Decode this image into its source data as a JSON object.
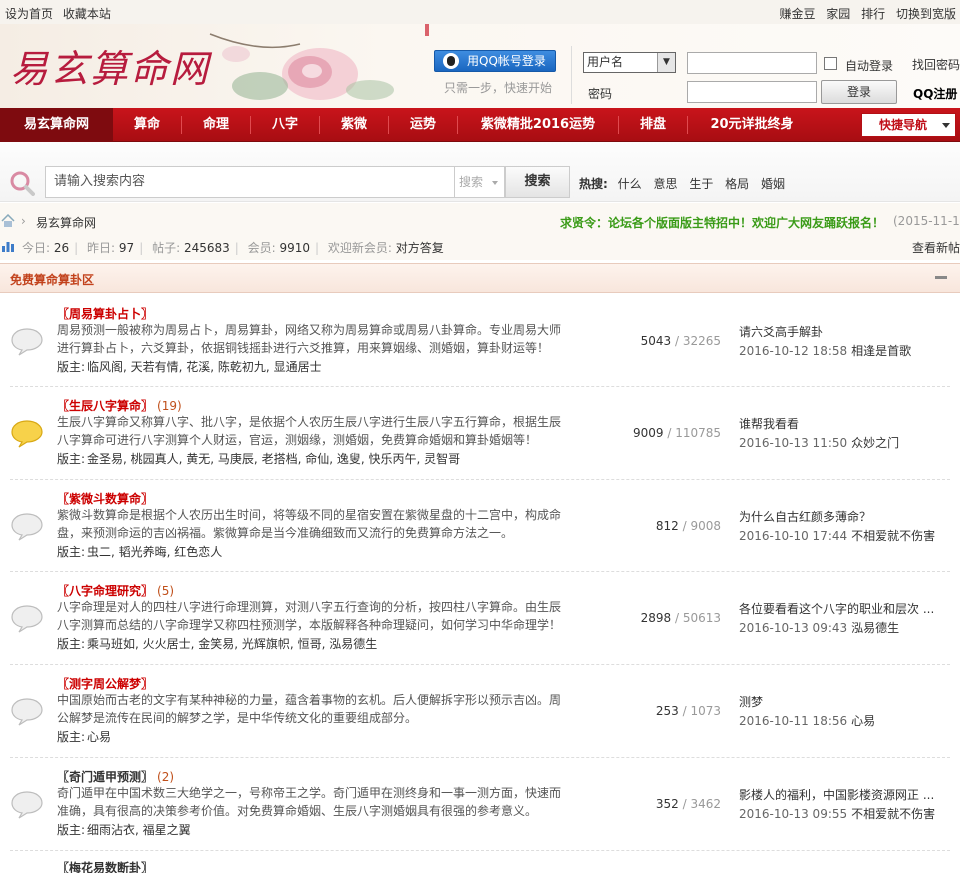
{
  "topbar": {
    "left": [
      "设为首页",
      "收藏本站"
    ],
    "right": [
      "赚金豆",
      "家园",
      "排行",
      "切换到宽版"
    ]
  },
  "header": {
    "logo": "易玄算命网",
    "qq_login": "用QQ帐号登录",
    "qq_hint": "只需一步，快速开始",
    "username_select": "用户名",
    "password_label": "密码",
    "auto_login": "自动登录",
    "find_password": "找回密码",
    "login_button": "登录",
    "qq_register": "QQ注册"
  },
  "nav": {
    "items": [
      "易玄算命网",
      "算命",
      "命理",
      "八字",
      "紫微",
      "运势",
      "紫微精批2016运势",
      "排盘",
      "20元详批终身"
    ],
    "quick": "快捷导航"
  },
  "search": {
    "placeholder": "请输入搜索内容",
    "type": "搜索",
    "button": "搜索",
    "hot_label": "热搜:",
    "hot": [
      "什么",
      "意思",
      "生于",
      "格局",
      "婚姻"
    ]
  },
  "breadcrumb": {
    "sep": "›",
    "current": "易玄算命网",
    "notice": "求贤令：论坛各个版面版主特招中！欢迎广大网友踊跃报名！",
    "notice_date": "(2015-11-1)"
  },
  "stats": {
    "today_label": "今日:",
    "today": "26",
    "yesterday_label": "昨日:",
    "yesterday": "97",
    "posts_label": "帖子:",
    "posts": "245683",
    "members_label": "会员:",
    "members": "9910",
    "welcome_label": "欢迎新会员:",
    "newest": "对方答复",
    "new_posts": "查看新帖"
  },
  "section": {
    "title": "免费算命算卦区"
  },
  "forums": [
    {
      "title": "〖周易算卦占卜〗",
      "today": "",
      "highlight": false,
      "desc": "周易预测一般被称为周易占卜，周易算卦，网络又称为周易算命或周易八卦算命。专业周易大师进行算卦占卜，六爻算卦，依据铜钱摇卦进行六爻推算，用来算姻缘、测婚姻，算卦财运等！",
      "mods_label": "版主:",
      "mods": "临风阁, 天若有情, 花溪, 陈乾初九, 显通居士",
      "threads": "5043",
      "posts": "32265",
      "last_title": "请六爻高手解卦",
      "last_time": "2016-10-12 18:58",
      "last_user": "相逢是首歌"
    },
    {
      "title": "〖生辰八字算命〗",
      "today": "(19)",
      "highlight": true,
      "desc": "生辰八字算命又称算八字、批八字，是依据个人农历生辰八字进行生辰八字五行算命，根据生辰八字算命可进行八字测算个人财运，官运，测姻缘，测婚姻，免费算命婚姻和算卦婚姻等！",
      "mods_label": "版主:",
      "mods": "金圣易, 桃园真人, 黄无, 马庚辰, 老搭档, 命仙, 逸叟, 快乐丙午, 灵智哥",
      "threads": "9009",
      "posts": "110785",
      "last_title": "谁帮我看看",
      "last_time": "2016-10-13 11:50",
      "last_user": "众妙之门"
    },
    {
      "title": "〖紫微斗数算命〗",
      "today": "",
      "highlight": false,
      "desc": "紫微斗数算命是根据个人农历出生时间，将等级不同的星宿安置在紫微星盘的十二宫中，构成命盘，来预测命运的吉凶祸福。紫微算命是当今准确细致而又流行的免费算命方法之一。",
      "mods_label": "版主:",
      "mods": "虫二, 韬光养晦, 红色恋人",
      "threads": "812",
      "posts": "9008",
      "last_title": "为什么自古红颜多薄命？",
      "last_time": "2016-10-10 17:44",
      "last_user": "不相爱就不伤害"
    },
    {
      "title": "〖八字命理研究〗",
      "today": "(5)",
      "highlight": false,
      "desc": "八字命理是对人的四柱八字进行命理测算，对测八字五行查询的分析，按四柱八字算命。由生辰八字测算而总结的八字命理学又称四柱预测学，本版解释各种命理疑问，如何学习中华命理学！",
      "mods_label": "版主:",
      "mods": "乘马班如, 火火居士, 金笑易, 光辉旗帜, 恒哥, 泓易德生",
      "threads": "2898",
      "posts": "50613",
      "last_title": "各位要看看这个八字的职业和层次 ...",
      "last_time": "2016-10-13 09:43",
      "last_user": "泓易德生"
    },
    {
      "title": "〖测字周公解梦〗",
      "today": "",
      "highlight": false,
      "desc": "中国原始而古老的文字有某种神秘的力量，蕴含着事物的玄机。后人便解拆字形以预示吉凶。周公解梦是流传在民间的解梦之学，是中华传统文化的重要组成部分。",
      "mods_label": "版主:",
      "mods": "心易",
      "threads": "253",
      "posts": "1073",
      "last_title": "测梦",
      "last_time": "2016-10-11 18:56",
      "last_user": "心易"
    },
    {
      "title": "〖奇门遁甲预测〗",
      "today": "(2)",
      "highlight": false,
      "dark": true,
      "desc": "奇门遁甲在中国术数三大绝学之一，号称帝王之学。奇门遁甲在测终身和一事一测方面，快速而准确，具有很高的决策参考价值。对免费算命婚姻、生辰八字测婚姻具有很强的参考意义。",
      "mods_label": "版主:",
      "mods": "细雨沾衣, 福星之翼",
      "threads": "352",
      "posts": "3462",
      "last_title": "影楼人的福利，中国影楼资源网正 ...",
      "last_time": "2016-10-13 09:55",
      "last_user": "不相爱就不伤害"
    },
    {
      "title": "〖梅花易数断卦〗",
      "today": "",
      "highlight": false,
      "dark": true
    }
  ]
}
